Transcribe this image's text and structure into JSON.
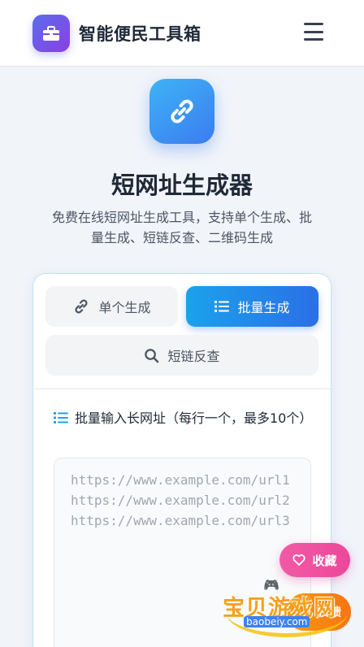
{
  "header": {
    "app_title": "智能便民工具箱",
    "logo_icon": "toolbox-icon",
    "menu_icon": "hamburger-menu-icon"
  },
  "hero": {
    "icon": "link-icon",
    "title": "短网址生成器",
    "description": "免费在线短网址生成工具，支持单个生成、批量生成、短链反查、二维码生成"
  },
  "tabs": [
    {
      "label": "单个生成",
      "icon": "link-icon",
      "active": false
    },
    {
      "label": "批量生成",
      "icon": "list-icon",
      "active": true
    },
    {
      "label": "短链反查",
      "icon": "search-icon",
      "active": false
    }
  ],
  "batch": {
    "label": "批量输入长网址（每行一个，最多10个）",
    "placeholder": "https://www.example.com/url1\nhttps://www.example.com/url2\nhttps://www.example.com/url3"
  },
  "floating": {
    "favorite_label": "收藏",
    "feedback_label": "反馈"
  },
  "watermark": {
    "text": "宝贝游戏网",
    "url": "baobeiy.com"
  },
  "colors": {
    "primary": "#2a6fe6",
    "accent_light": "#1ba2ec",
    "favorite": "#ec4899",
    "feedback": "#f97316",
    "logo": "#7c4ae8"
  }
}
